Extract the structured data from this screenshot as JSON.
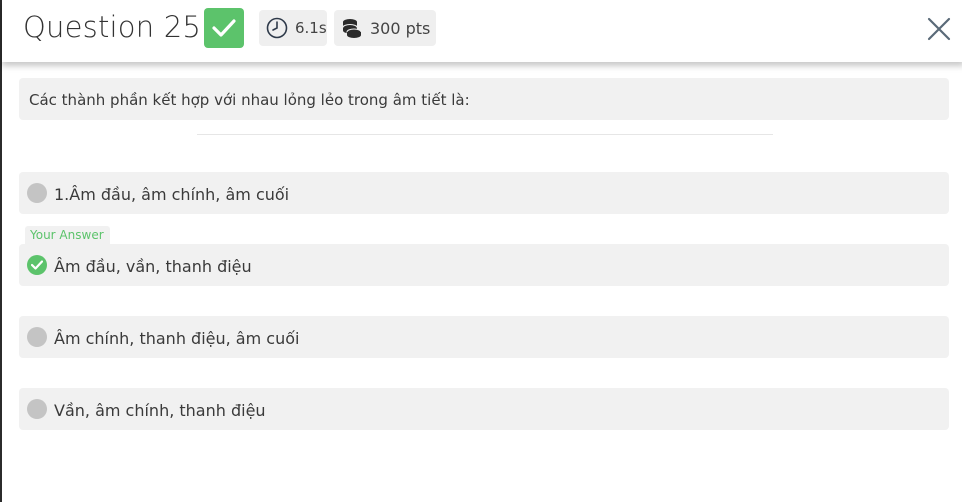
{
  "header": {
    "title": "Question 25",
    "status": "correct",
    "time": "6.1s",
    "points": "300 pts",
    "close_icon": "close-icon"
  },
  "question": {
    "text": "Các thành phần kết hợp với nhau lỏng lẻo trong âm tiết là:"
  },
  "your_answer_label": "Your Answer",
  "options": [
    {
      "label": "1.Âm đầu, âm chính, âm cuối",
      "state": "unselected"
    },
    {
      "label": "Âm đầu, vần, thanh điệu",
      "state": "correct-selected"
    },
    {
      "label": "Âm chính, thanh điệu, âm cuối",
      "state": "unselected"
    },
    {
      "label": "Vần, âm chính, thanh điệu",
      "state": "unselected"
    }
  ],
  "colors": {
    "correct": "#5cc36b",
    "chip_bg": "#efefef",
    "option_bg": "#f1f1f1",
    "radio_gray": "#c4c4c4"
  }
}
